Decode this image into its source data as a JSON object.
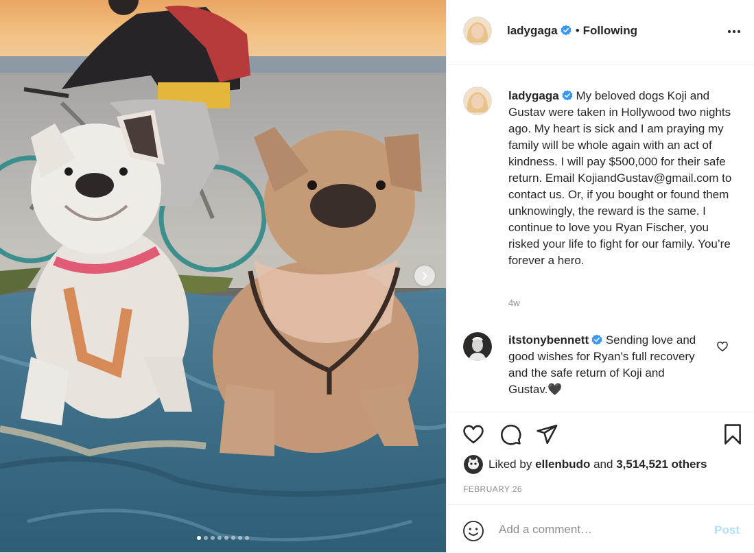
{
  "post": {
    "author": "ladygaga",
    "verified": true,
    "separator": "•",
    "follow_status": "Following",
    "more_icon": "more-horizontal-icon",
    "caption_author": "ladygaga",
    "caption": "My beloved dogs Koji and Gustav were taken in Hollywood two nights ago. My heart is sick and I am praying my family will be whole again with an act of kindness. I will pay $500,000 for their safe return. Email KojiandGustav@gmail.com to contact us. Or, if you bought or found them unknowingly, the reward is the same. I continue to love you Ryan Fischer, you risked your life to fight for our family. You’re forever a hero.",
    "time_ago": "4w"
  },
  "comments": [
    {
      "author": "itstonybennett",
      "verified": true,
      "text": "Sending love and good wishes for Ryan's full recovery and the safe return of Koji and Gustav.🖤"
    }
  ],
  "actions": {
    "like_icon": "heart-icon",
    "comment_icon": "comment-icon",
    "share_icon": "paper-plane-icon",
    "save_icon": "bookmark-icon"
  },
  "likes": {
    "prefix": "Liked by",
    "user": "ellenbudo",
    "and": "and",
    "count": "3,514,521 others"
  },
  "date": "FEBRUARY 26",
  "add_comment": {
    "placeholder": "Add a comment…",
    "post_label": "Post",
    "emoji_icon": "smiley-icon"
  },
  "carousel": {
    "total_slides": 8,
    "current_slide": 1,
    "next_icon": "chevron-right-icon"
  },
  "colors": {
    "verified": "#3897f0",
    "text": "#262626",
    "muted": "#8e8e8e",
    "post_disabled": "#b2dffc"
  }
}
